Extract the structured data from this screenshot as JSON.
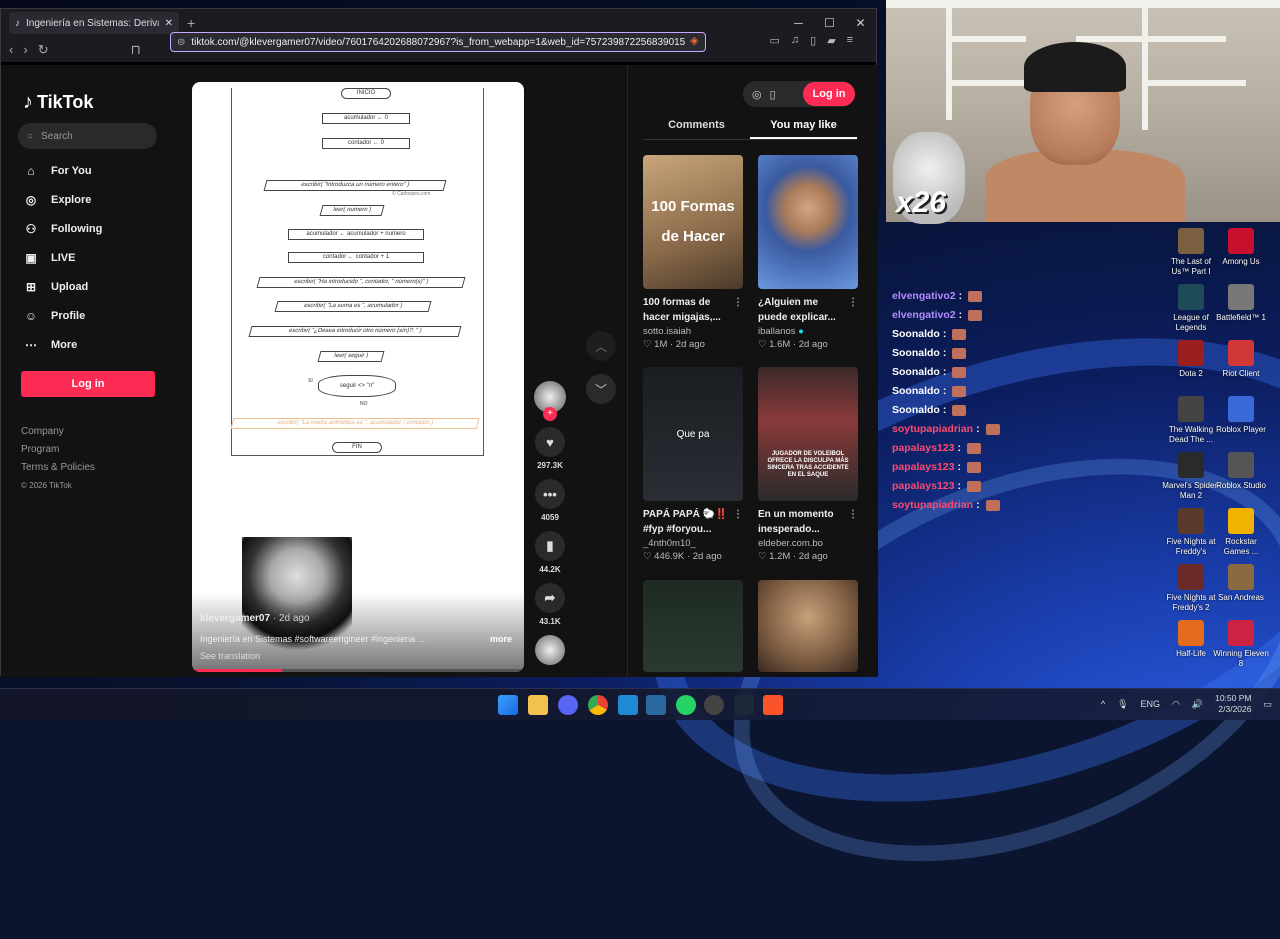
{
  "browser": {
    "tab_title": "Ingeniería en Sistemas: Derivada",
    "url": "tiktok.com/@klevergamer07/video/7601764202688072967?is_from_webapp=1&web_id=757239872256839015",
    "win_min": "─",
    "win_max": "☐",
    "win_close": "✕"
  },
  "tiktok": {
    "logo": "TikTok",
    "search_placeholder": "Search",
    "nav": [
      {
        "label": "For You",
        "icon": "home-icon"
      },
      {
        "label": "Explore",
        "icon": "compass-icon"
      },
      {
        "label": "Following",
        "icon": "following-icon"
      },
      {
        "label": "LIVE",
        "icon": "live-icon"
      },
      {
        "label": "Upload",
        "icon": "upload-icon"
      },
      {
        "label": "Profile",
        "icon": "profile-icon"
      },
      {
        "label": "More",
        "icon": "more-icon"
      }
    ],
    "login": "Log in",
    "footer": {
      "company": "Company",
      "program": "Program",
      "terms": "Terms & Policies",
      "copyright": "© 2026 TikTok"
    },
    "video": {
      "author": "klevergamer07",
      "date": "· 2d ago",
      "caption": "Ingeniería en Sistemas #softwareengineer #ingenieria ...",
      "more": "more",
      "translation": "See translation",
      "progress": 0.27,
      "flow": {
        "start": "INICIO",
        "s1": "acumulador ← 0",
        "s2": "contador ← 0",
        "s3": "escribir( \"Introduzca un número entero\" )",
        "watermark": "© Carlospes.com",
        "s4": "leer( numero )",
        "s5": "acumulador ← acumulador + numero",
        "s6": "contador ← contador + 1",
        "s7": "escribir( \"Ha introducido \", contador, \" número(s)\" )",
        "s8": "escribir( \"La suma es \", acumulador )",
        "s9": "escribir( \"¿Desea introducir otro número (s/n)?: \" )",
        "s10": "leer( seguir )",
        "cond": "seguir <> \"n\"",
        "yes": "SI",
        "no": "NO",
        "s11": "escribir( \"La media aritmética es \", acumulador / contador )",
        "end": "FIN"
      }
    },
    "actions": {
      "likes": "297.3K",
      "comments": "4059",
      "saves": "44.2K",
      "shares": "43.1K"
    },
    "panel": {
      "tab_comments": "Comments",
      "tab_you_may_like": "You may like",
      "cards": [
        {
          "thumb_text": "100 Formas de Hacer",
          "title": "100 formas de hacer migajas,...",
          "author": "sotto.isaiah",
          "stats": "1M · 2d ago"
        },
        {
          "thumb_text": "",
          "title": "¿Alguien me puede explicar...",
          "author": "iballanos",
          "stats": "1.6M · 2d ago"
        },
        {
          "thumb_text": "Que pa",
          "title": "PAPÁ PAPÁ 🐑‼️ #fyp #foryou...",
          "author": "_4nth0m10_",
          "stats": "446.9K · 2d ago"
        },
        {
          "thumb_text": "JUGADOR DE VOLEIBOL OFRECE LA DISCULPA MÁS SINCERA TRAS ACCIDENTE EN EL SAQUE",
          "title": "En un momento inesperado...",
          "author": "eldeber.com.bo",
          "stats": "1.2M · 2d ago"
        },
        {
          "thumb_text": "",
          "title": "",
          "author": "",
          "stats": ""
        },
        {
          "thumb_text": "",
          "title": "",
          "author": "",
          "stats": ""
        }
      ]
    }
  },
  "stream": {
    "counter": "x26",
    "chat": [
      {
        "user": "elvengativo2",
        "color": "#b48cff"
      },
      {
        "user": "elvengativo2",
        "color": "#b48cff"
      },
      {
        "user": "Soonaldo",
        "color": "#ffffff"
      },
      {
        "user": "Soonaldo",
        "color": "#ffffff"
      },
      {
        "user": "Soonaldo",
        "color": "#ffffff"
      },
      {
        "user": "Soonaldo",
        "color": "#ffffff"
      },
      {
        "user": "Soonaldo",
        "color": "#ffffff"
      },
      {
        "user": "soytupapiadrian",
        "color": "#ff4a6e"
      },
      {
        "user": "papalays123",
        "color": "#ff4a6e"
      },
      {
        "user": "papalays123",
        "color": "#ff4a6e"
      },
      {
        "user": "papalays123",
        "color": "#ff4a6e"
      },
      {
        "user": "soytupapiadrian",
        "color": "#ff4a6e"
      }
    ]
  },
  "desktop_icons": [
    {
      "label": "The Last of Us™ Part I",
      "color": "#7a6040"
    },
    {
      "label": "Among Us",
      "color": "#c8102e"
    },
    {
      "label": "League of Legends",
      "color": "#1e4a5a"
    },
    {
      "label": "Battlefield™ 1",
      "color": "#777777"
    },
    {
      "label": "Dota 2",
      "color": "#9c1f1f"
    },
    {
      "label": "Riot Client",
      "color": "#d13639"
    },
    {
      "label": "The Walking Dead The ...",
      "color": "#444444"
    },
    {
      "label": "Roblox Player",
      "color": "#3a6ad8"
    },
    {
      "label": "Marvel's Spider-Man 2",
      "color": "#2a2a2a"
    },
    {
      "label": "Roblox Studio",
      "color": "#555555"
    },
    {
      "label": "Five Nights at Freddy's",
      "color": "#5a3a2a"
    },
    {
      "label": "Rockstar Games ...",
      "color": "#f2b300"
    },
    {
      "label": "Five Nights at Freddy's 2",
      "color": "#6a2a2a"
    },
    {
      "label": "San Andreas",
      "color": "#8a6a40"
    },
    {
      "label": "Half-Life",
      "color": "#e46b1e"
    },
    {
      "label": "Winning Eleven 8",
      "color": "#cc2244"
    }
  ],
  "taskbar": {
    "lang": "ENG",
    "time": "10:50 PM",
    "date": "2/3/2026",
    "wifi": "◠",
    "volume": "🔊"
  }
}
